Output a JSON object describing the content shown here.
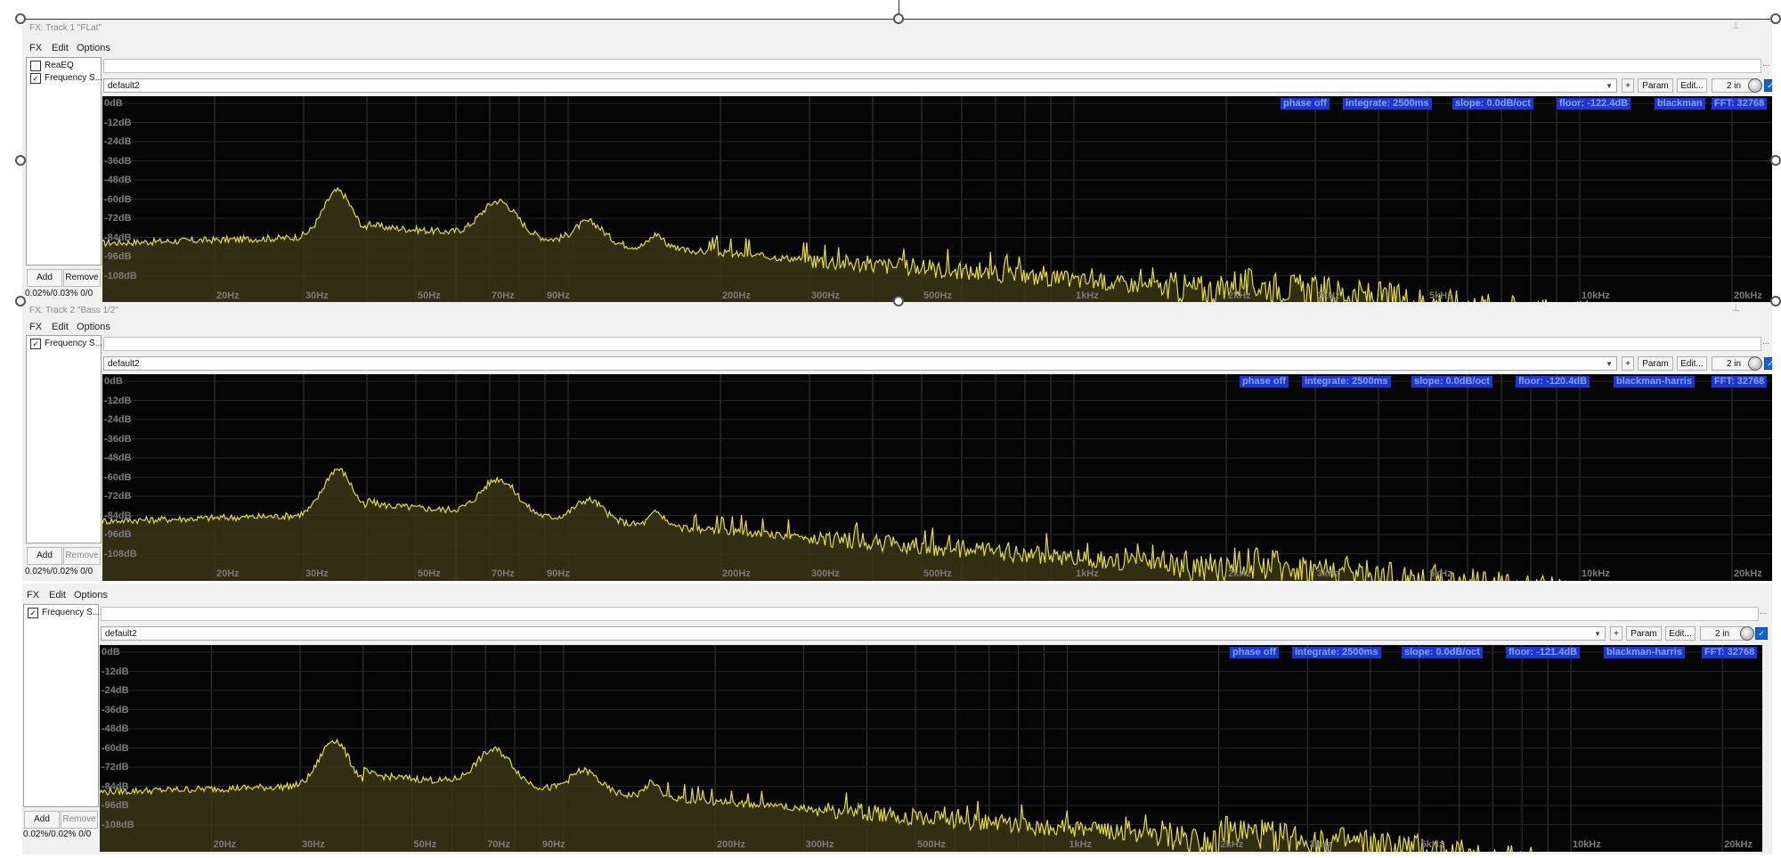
{
  "windows": [
    {
      "title": "FX: Track 1 \"FLat\"",
      "menu": [
        "FX",
        "Edit",
        "Options"
      ],
      "fx_items": [
        {
          "label": "ReaEQ",
          "checked": false
        },
        {
          "label": "Frequency S...",
          "checked": true
        }
      ],
      "add_label": "Add",
      "remove_label": "Remove",
      "cpu": "0.02%/0.03% 0/0",
      "preset": "default2",
      "plus_label": "+",
      "param_label": "Param",
      "edit_label": "Edit...",
      "io_label": "2 in",
      "status_tags": [
        "phase off",
        "integrate: 2500ms",
        "slope: 0.0dB/oct",
        "floor: -122.4dB",
        "blackman",
        "FFT: 32768"
      ]
    },
    {
      "title": "FX: Track 2 \"Bass 1/2\"",
      "menu": [
        "FX",
        "Edit",
        "Options"
      ],
      "fx_items": [
        {
          "label": "Frequency S...",
          "checked": true
        }
      ],
      "add_label": "Add",
      "remove_label": "Remove",
      "cpu": "0.02%/0.02% 0/0",
      "preset": "default2",
      "plus_label": "+",
      "param_label": "Param",
      "edit_label": "Edit...",
      "io_label": "2 in",
      "status_tags": [
        "phase off",
        "integrate: 2500ms",
        "slope: 0.0dB/oct",
        "floor: -120.4dB",
        "blackman-harris",
        "FFT: 32768"
      ]
    },
    {
      "title": "",
      "menu": [
        "FX",
        "Edit",
        "Options"
      ],
      "fx_items": [
        {
          "label": "Frequency S...",
          "checked": true
        }
      ],
      "add_label": "Add",
      "remove_label": "Remove",
      "cpu": "0.02%/0.02% 0/0",
      "preset": "default2",
      "plus_label": "+",
      "param_label": "Param",
      "edit_label": "Edit...",
      "io_label": "2 in",
      "status_tags": [
        "phase off",
        "integrate: 2500ms",
        "slope: 0.0dB/oct",
        "floor: -121.4dB",
        "blackman-harris",
        "FFT: 32768"
      ]
    }
  ],
  "spectrum": {
    "db_labels": [
      "0dB",
      "-12dB",
      "-24dB",
      "-36dB",
      "-48dB",
      "-60dB",
      "-72dB",
      "-84dB",
      "-96dB",
      "-108dB"
    ],
    "freq_labels": [
      {
        "label": "20Hz",
        "hz": 20
      },
      {
        "label": "30Hz",
        "hz": 30
      },
      {
        "label": "50Hz",
        "hz": 50
      },
      {
        "label": "70Hz",
        "hz": 70
      },
      {
        "label": "90Hz",
        "hz": 90
      },
      {
        "label": "200Hz",
        "hz": 200
      },
      {
        "label": "300Hz",
        "hz": 300
      },
      {
        "label": "500Hz",
        "hz": 500
      },
      {
        "label": "1kHz",
        "hz": 1000
      },
      {
        "label": "2kHz",
        "hz": 2000
      },
      {
        "label": "3kHz",
        "hz": 3000
      },
      {
        "label": "5kHz",
        "hz": 5000
      },
      {
        "label": "10kHz",
        "hz": 10000
      },
      {
        "label": "20kHz",
        "hz": 20000
      }
    ],
    "colors": {
      "background": "#050505",
      "grid": "#3a3a3a",
      "line": "#e6dc3c",
      "fill": "#3a3616",
      "tag_bg": "#1d35d8",
      "tag_text": "#7fa8ff"
    }
  }
}
